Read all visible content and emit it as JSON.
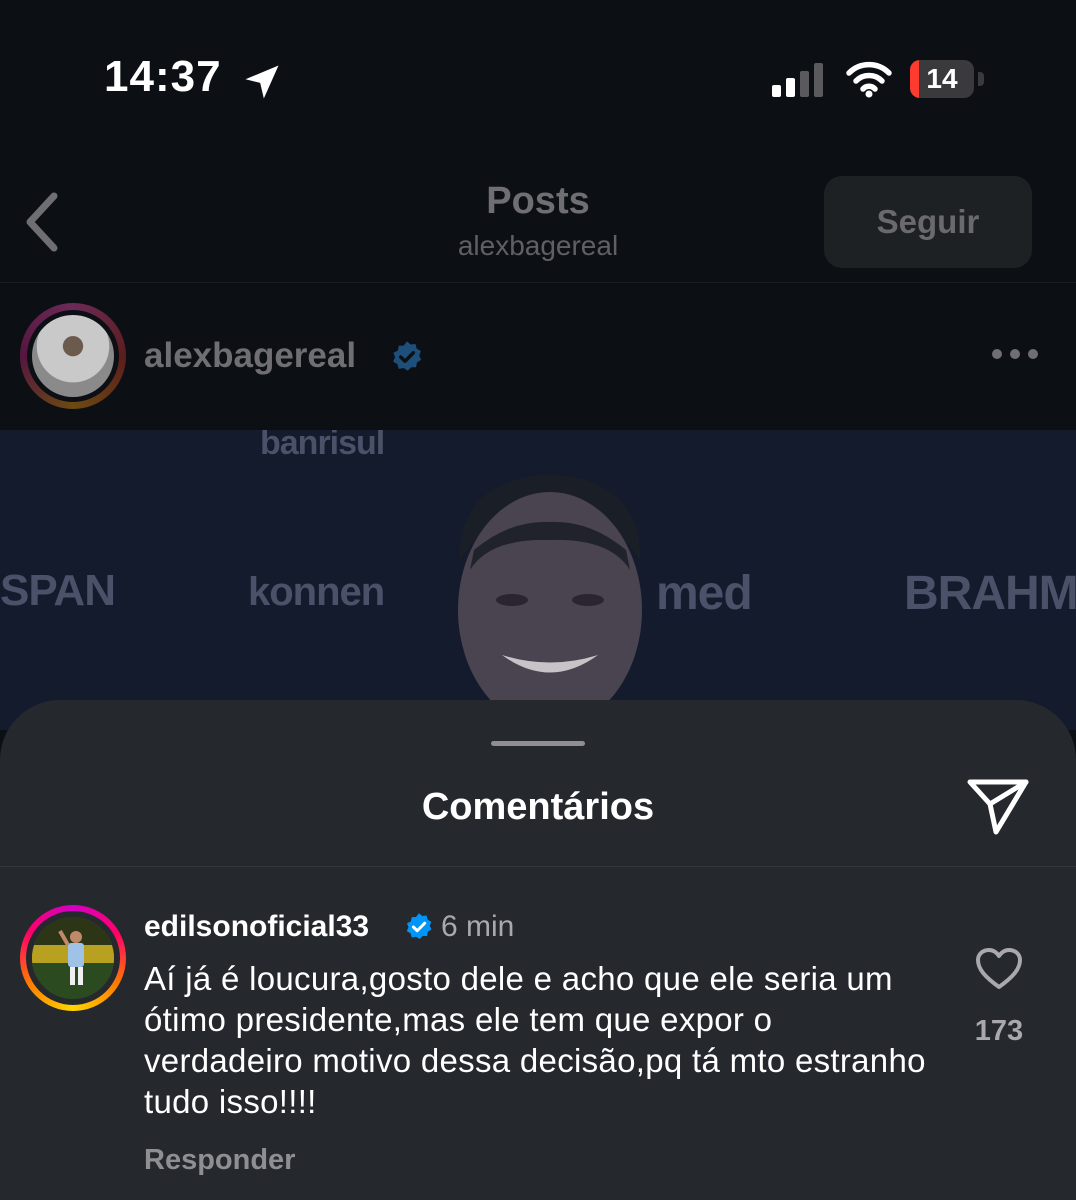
{
  "status_bar": {
    "time": "14:37",
    "battery_level": "14",
    "battery_fraction": 0.14,
    "signal_bars_active": 2,
    "signal_bars_total": 4
  },
  "header": {
    "title": "Posts",
    "subtitle": "alexbagereal",
    "follow_label": "Seguir"
  },
  "post": {
    "author": "alexbagereal",
    "image_texts": [
      "banrisul",
      "SPAN",
      "konnen",
      "med",
      "BRAHMA"
    ]
  },
  "comments_sheet": {
    "title": "Comentários",
    "comment": {
      "username": "edilsonoficial33",
      "time": "6 min",
      "text": "Aí já é loucura,gosto dele e acho que ele seria um ótimo presidente,mas ele tem que expor o verdadeiro motivo dessa decisão,pq tá mto estranho tudo isso!!!!",
      "reply_label": "Responder",
      "likes": "173"
    }
  },
  "colors": {
    "background": "#0c1014",
    "sheet": "#25292e",
    "verified": "#0095f6",
    "battery_low": "#ff3b30"
  },
  "icons": [
    "location-arrow-icon",
    "signal-icon",
    "wifi-icon",
    "battery-icon",
    "back-chevron-icon",
    "verified-badge-icon",
    "more-options-icon",
    "share-paper-plane-icon",
    "heart-icon"
  ]
}
